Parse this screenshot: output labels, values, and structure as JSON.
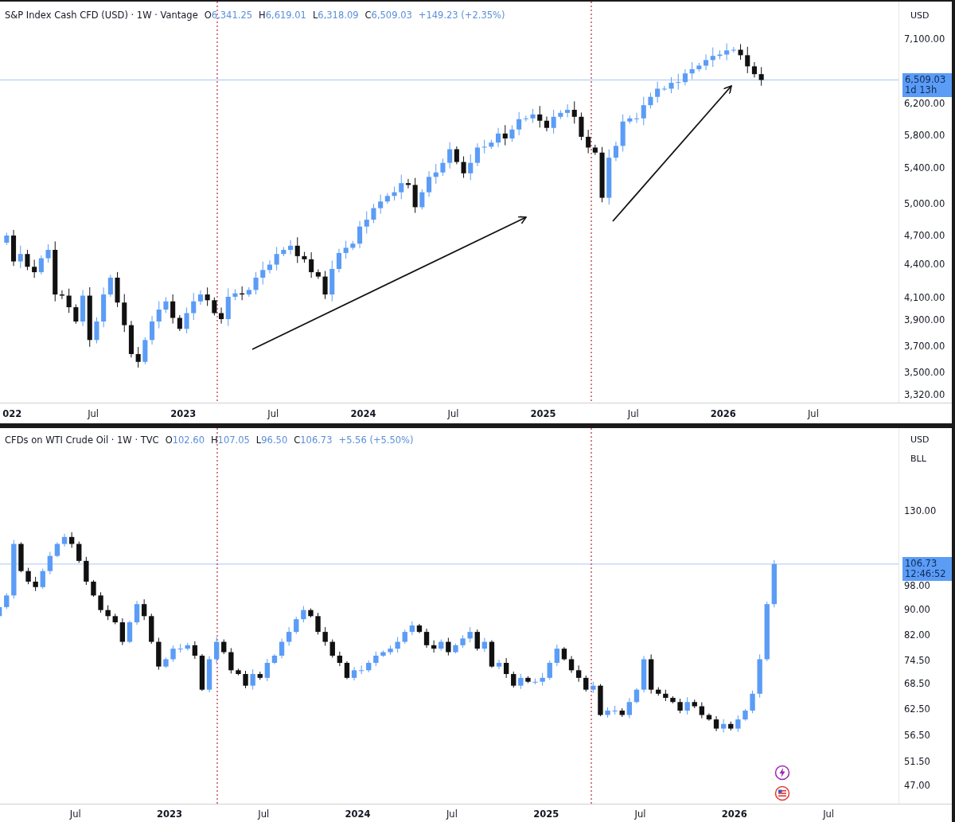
{
  "panes": [
    {
      "legend": {
        "title": "S&P Index Cash CFD (USD) · 1W · Vantage",
        "fields": [
          {
            "key": "O",
            "value": "6,341.25"
          },
          {
            "key": "H",
            "value": "6,619.01"
          },
          {
            "key": "L",
            "value": "6,318.09"
          },
          {
            "key": "C",
            "value": "6,509.03"
          }
        ],
        "change": "+149.23 (+2.35%)"
      },
      "units": [
        "USD"
      ],
      "price_scale": [
        "7,100.00",
        "6,200.00",
        "5,800.00",
        "5,400.00",
        "5,000.00",
        "4,700.00",
        "4,400.00",
        "4,100.00",
        "3,900.00",
        "3,700.00",
        "3,500.00",
        "3,320.00"
      ],
      "price_label": {
        "price": "6,509.03",
        "countdown": "1d 13h"
      },
      "time_scale": [
        {
          "label": "022",
          "kind": "year"
        },
        {
          "label": "Jul",
          "kind": "month"
        },
        {
          "label": "2023",
          "kind": "year"
        },
        {
          "label": "Jul",
          "kind": "month"
        },
        {
          "label": "2024",
          "kind": "year"
        },
        {
          "label": "Jul",
          "kind": "month"
        },
        {
          "label": "2025",
          "kind": "year"
        },
        {
          "label": "Jul",
          "kind": "month"
        },
        {
          "label": "2026",
          "kind": "year"
        },
        {
          "label": "Jul",
          "kind": "month"
        }
      ]
    },
    {
      "legend": {
        "title": "CFDs on WTI Crude Oil · 1W · TVC",
        "fields": [
          {
            "key": "O",
            "value": "102.60"
          },
          {
            "key": "H",
            "value": "107.05"
          },
          {
            "key": "L",
            "value": "96.50"
          },
          {
            "key": "C",
            "value": "106.73"
          }
        ],
        "change": "+5.56 (+5.50%)"
      },
      "units": [
        "USD",
        "BLL"
      ],
      "price_scale": [
        "130.00",
        "98.00",
        "90.00",
        "82.00",
        "74.50",
        "68.50",
        "62.50",
        "56.50",
        "51.50",
        "47.00"
      ],
      "price_label": {
        "price": "106.73",
        "countdown": "12:46:52"
      },
      "time_scale": [
        {
          "label": "Jul",
          "kind": "month"
        },
        {
          "label": "2023",
          "kind": "year"
        },
        {
          "label": "Jul",
          "kind": "month"
        },
        {
          "label": "2024",
          "kind": "year"
        },
        {
          "label": "Jul",
          "kind": "month"
        },
        {
          "label": "2025",
          "kind": "year"
        },
        {
          "label": "Jul",
          "kind": "month"
        },
        {
          "label": "2026",
          "kind": "year"
        },
        {
          "label": "Jul",
          "kind": "month"
        }
      ]
    }
  ]
}
